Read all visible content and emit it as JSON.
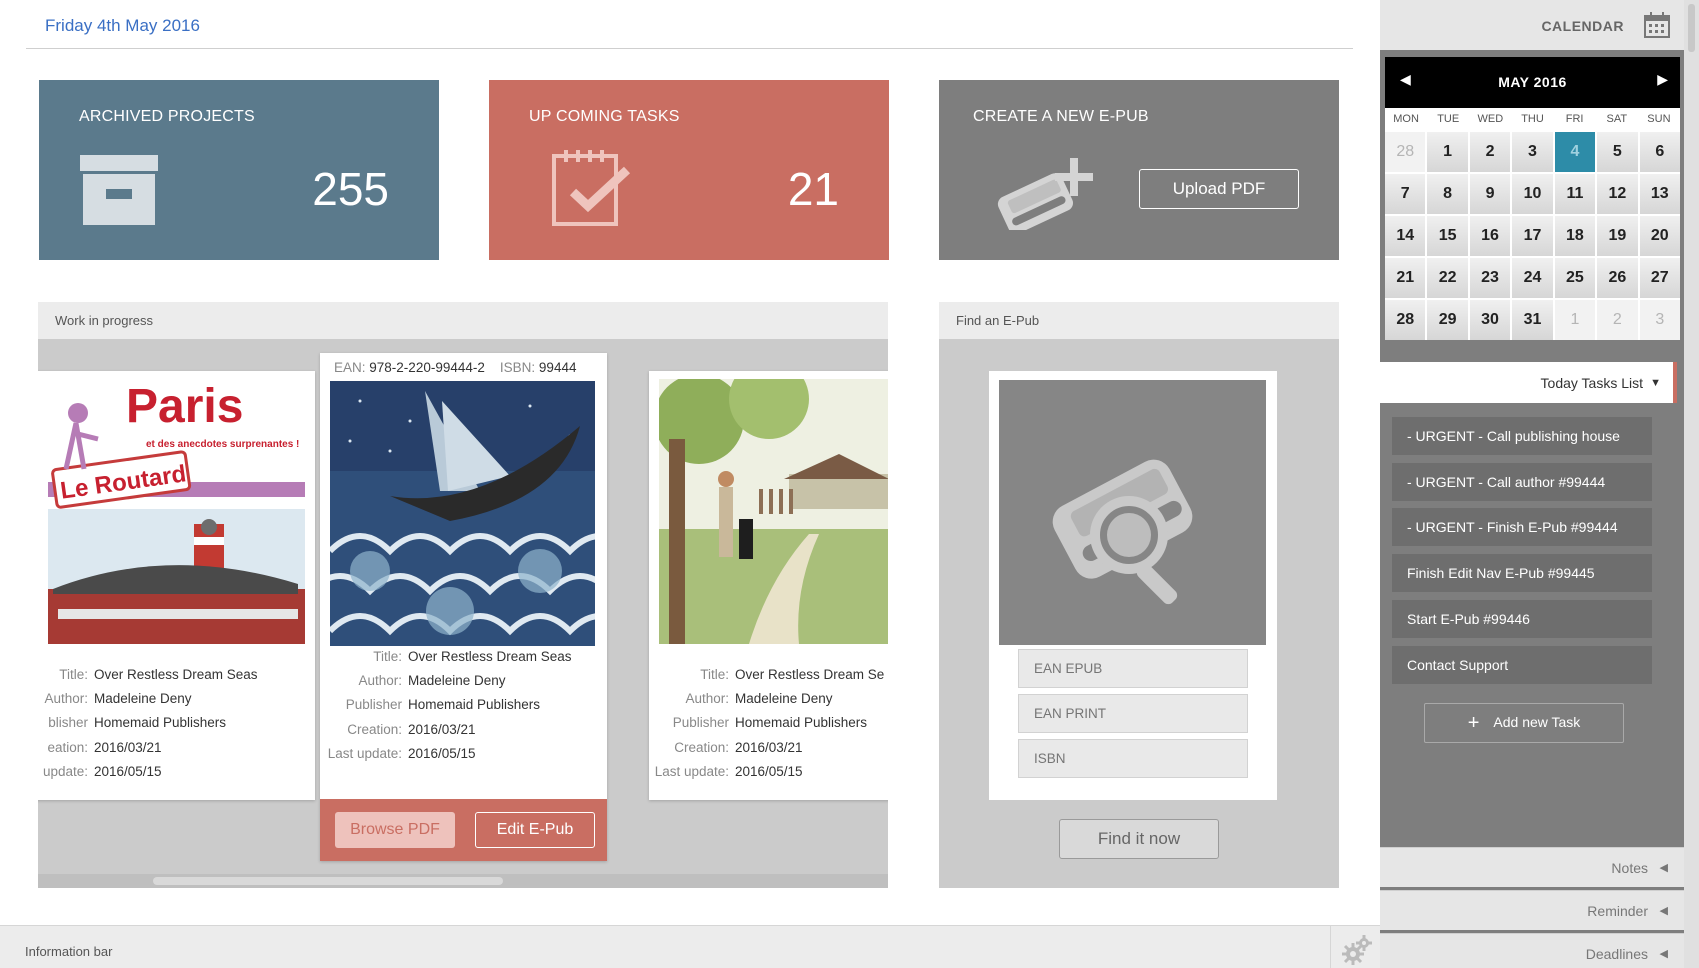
{
  "header": {
    "date": "Friday 4th May 2016"
  },
  "stats": {
    "archived": {
      "label": "ARCHIVED PROJECTS",
      "count": "255",
      "icon": "archive-box-icon"
    },
    "tasks": {
      "label": "UP COMING TASKS",
      "count": "21",
      "icon": "checklist-icon"
    },
    "create": {
      "label": "CREATE  A NEW E-PUB",
      "button": "Upload PDF",
      "icon": "add-book-icon"
    }
  },
  "wip": {
    "title": "Work in progress",
    "left": {
      "cover_title": "Paris",
      "cover_subtitle": "et des anecdotes surprenantes !",
      "cover_brand": "Le Routard",
      "fields": [
        {
          "k": "Title:",
          "v": "Over Restless Dream Seas"
        },
        {
          "k": "Author:",
          "v": "Madeleine Deny"
        },
        {
          "k": "blisher",
          "v": "Homemaid Publishers"
        },
        {
          "k": "eation:",
          "v": "2016/03/21"
        },
        {
          "k": "update:",
          "v": "2016/05/15"
        }
      ]
    },
    "center": {
      "ean_label": "EAN:",
      "ean": "978-2-220-99444-2",
      "isbn_label": "ISBN:",
      "isbn": "99444",
      "fields": [
        {
          "k": "Title:",
          "v": "Over Restless Dream Seas"
        },
        {
          "k": "Author:",
          "v": "Madeleine Deny"
        },
        {
          "k": "Publisher",
          "v": "Homemaid Publishers"
        },
        {
          "k": "Creation:",
          "v": "2016/03/21"
        },
        {
          "k": "Last update:",
          "v": "2016/05/15"
        }
      ],
      "browse_label": "Browse PDF",
      "edit_label": "Edit E-Pub"
    },
    "right": {
      "fields": [
        {
          "k": "Title:",
          "v": "Over Restless Dream Se"
        },
        {
          "k": "Author:",
          "v": "Madeleine Deny"
        },
        {
          "k": "Publisher",
          "v": "Homemaid Publishers"
        },
        {
          "k": "Creation:",
          "v": "2016/03/21"
        },
        {
          "k": "Last update:",
          "v": "2016/05/15"
        }
      ]
    }
  },
  "find": {
    "title": "Find an E-Pub",
    "ean_epub_placeholder": "EAN EPUB",
    "ean_print_placeholder": "EAN PRINT",
    "isbn_placeholder": "ISBN",
    "button": "Find it now",
    "icon": "book-search-icon"
  },
  "infobar": {
    "label": "Information bar"
  },
  "sidebar": {
    "calendar_label": "CALENDAR",
    "calendar": {
      "title": "MAY  2016",
      "prev": "◀",
      "next": "▶",
      "dows": [
        "MON",
        "TUE",
        "WED",
        "THU",
        "FRI",
        "SAT",
        "SUN"
      ],
      "days": [
        {
          "d": "28",
          "o": true
        },
        {
          "d": "1"
        },
        {
          "d": "2"
        },
        {
          "d": "3"
        },
        {
          "d": "4",
          "t": true
        },
        {
          "d": "5"
        },
        {
          "d": "6"
        },
        {
          "d": "7"
        },
        {
          "d": "8"
        },
        {
          "d": "9"
        },
        {
          "d": "10"
        },
        {
          "d": "11"
        },
        {
          "d": "12"
        },
        {
          "d": "13"
        },
        {
          "d": "14"
        },
        {
          "d": "15"
        },
        {
          "d": "16"
        },
        {
          "d": "17"
        },
        {
          "d": "18"
        },
        {
          "d": "19"
        },
        {
          "d": "20"
        },
        {
          "d": "21"
        },
        {
          "d": "22"
        },
        {
          "d": "23"
        },
        {
          "d": "24"
        },
        {
          "d": "25"
        },
        {
          "d": "26"
        },
        {
          "d": "27"
        },
        {
          "d": "28"
        },
        {
          "d": "29"
        },
        {
          "d": "30"
        },
        {
          "d": "31"
        },
        {
          "d": "1",
          "o": true
        },
        {
          "d": "2",
          "o": true
        },
        {
          "d": "3",
          "o": true
        }
      ]
    },
    "tasks_title": "Today Tasks List",
    "tasks": [
      "- URGENT - Call publishing house",
      " - URGENT - Call author #99444",
      " - URGENT - Finish E-Pub #99444",
      "Finish Edit Nav E-Pub #99445",
      "Start E-Pub #99446",
      "Contact Support"
    ],
    "add_task": "Add new Task",
    "notes": "Notes",
    "reminder": "Reminder",
    "deadlines": "Deadlines"
  },
  "colors": {
    "archived": "#5b7a8c",
    "tasks": "#c96e62",
    "create": "#7e7e7e",
    "accent_blue": "#3a6fc4",
    "today": "#2d8ca8"
  }
}
